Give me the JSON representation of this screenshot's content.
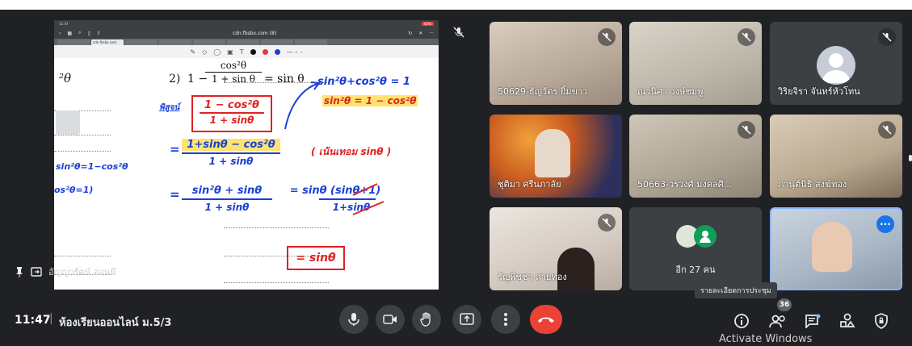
{
  "presentation": {
    "browser_url": "cdn.fbsbx.com (8)",
    "ipad_time": "11:47",
    "battery": "62%",
    "active_tab": "cdn.fbsbx.com",
    "problem_number": "2)",
    "problem_left": "1 −",
    "problem_numerator": "cos²θ",
    "problem_denominator": "1 + sin θ",
    "problem_right": "= sin θ",
    "left_theta": "²θ",
    "proof_label": "พิสูจน์",
    "step1_num": "1 − cos²θ",
    "step1_den": "1 + sinθ",
    "step2_eq": "=",
    "step2_num": "1+sinθ − cos²θ",
    "step2_den": "1 + sinθ",
    "step3_eq": "=",
    "step3_num": "sin²θ + sinθ",
    "step3_den": "1 + sinθ",
    "step3_right": "= sinθ (sinθ+1)",
    "step3_right_den": "1+sinθ",
    "final_answer": "= sinθ",
    "note_identity": "sin²θ+cos²θ = 1",
    "note_identity2": "sin²θ = 1 − cos²θ",
    "note_focus": "( เน้นเทอม sinθ )",
    "left_note1": "sin²θ=1−cos²θ",
    "left_note2": "os²θ=1)",
    "presenter_name": "อัญญารัตน์ อ่อนมี"
  },
  "participants": [
    {
      "name": "50629-ธัญวัตร ยิ้มขาว",
      "muted": true
    },
    {
      "name": "ณวนิศา วงษ์ชมพู",
      "muted": true
    },
    {
      "name": "วิริยจิรา จันทร์หัวโทน",
      "muted": true,
      "avatar": "person-icon"
    },
    {
      "name": "ชุติมา ศรีนภาลัย",
      "muted": false
    },
    {
      "name": "50663-วรวงศ์ มงคลศิ...",
      "muted": true
    },
    {
      "name": "ภานุต์นิธิ สงฆ์ทอง",
      "muted": true
    },
    {
      "name": "รัญพิชชา สายทอง",
      "muted": true
    },
    {
      "name": "",
      "muted": false
    }
  ],
  "others_tile": {
    "label": "อีก 27 คน"
  },
  "bottom_bar": {
    "time": "11:47",
    "separator": "|",
    "meeting_name": "ห้องเรียนออนไลน์ ม.5/3",
    "participant_count": "36",
    "tooltip": "รายละเอียดการประชุม",
    "watermark": "Activate Windows"
  },
  "colors": {
    "end_call": "#ea4335",
    "accent": "#1a73e8",
    "background": "#202124"
  }
}
